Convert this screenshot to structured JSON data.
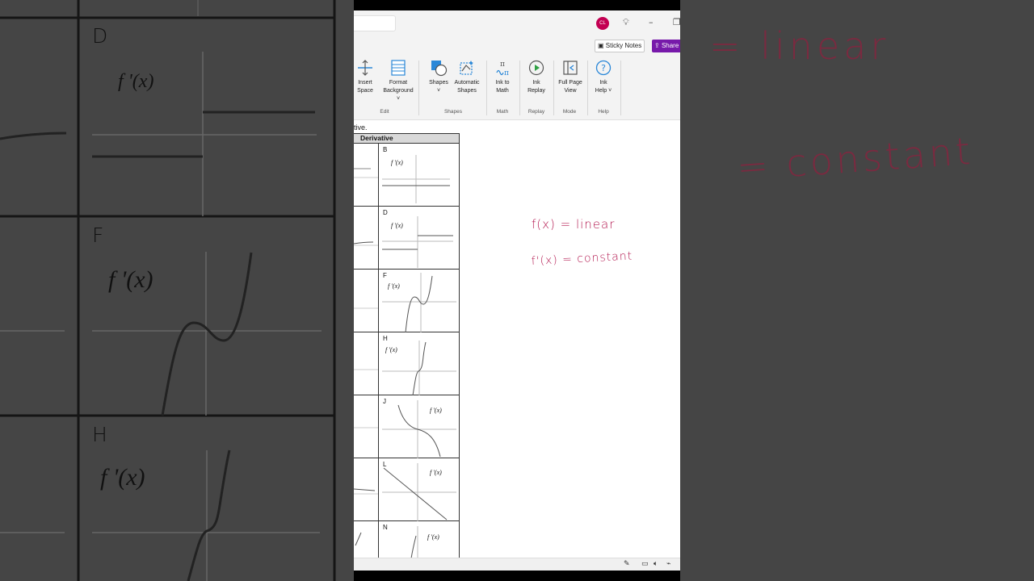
{
  "window": {
    "avatar_initials": "CL",
    "sticky_notes_label": "Sticky Notes",
    "share_label": "Share"
  },
  "ribbon": {
    "buttons": [
      {
        "label1": "Insert",
        "label2": "Space",
        "icon": "insert-space-icon"
      },
      {
        "label1": "Format",
        "label2": "Background ˅",
        "icon": "format-background-icon"
      },
      {
        "label1": "Shapes",
        "label2": "˅",
        "icon": "shapes-icon"
      },
      {
        "label1": "Automatic",
        "label2": "Shapes",
        "icon": "automatic-shapes-icon"
      },
      {
        "label1": "Ink to",
        "label2": "Math",
        "icon": "ink-to-math-icon"
      },
      {
        "label1": "Ink",
        "label2": "Replay",
        "icon": "ink-replay-icon"
      },
      {
        "label1": "Full Page",
        "label2": "View",
        "icon": "full-page-view-icon"
      },
      {
        "label1": "Ink",
        "label2": "Help ˅",
        "icon": "ink-help-icon"
      }
    ],
    "groups": [
      "Edit",
      "Shapes",
      "Math",
      "Replay",
      "Mode",
      "Help"
    ],
    "accent": "#2b88d8"
  },
  "page": {
    "hint_fragment": "tive.",
    "table_header": "Derivative",
    "cells": [
      {
        "letter": "B",
        "label": "f '(x)"
      },
      {
        "letter": "D",
        "label": "f '(x)"
      },
      {
        "letter": "F",
        "label": "f '(x)"
      },
      {
        "letter": "H",
        "label": "f '(x)"
      },
      {
        "letter": "J",
        "label": "f '(x)"
      },
      {
        "letter": "L",
        "label": "f '(x)"
      },
      {
        "letter": "N",
        "label": "f '(x)"
      }
    ],
    "ink_color": "#b3174f",
    "ink_lines": [
      "f(x) = linear",
      "f'(x) = constant"
    ]
  },
  "background": {
    "left_letters": [
      "D",
      "F",
      "H"
    ],
    "left_label": "f '(x)",
    "right_lines": [
      "= linear",
      "= constant"
    ]
  }
}
